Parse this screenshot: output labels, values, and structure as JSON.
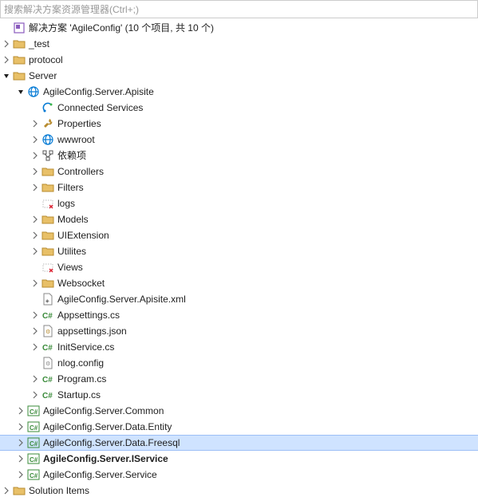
{
  "search": {
    "placeholder": "搜索解决方案资源管理器(Ctrl+;)"
  },
  "solution": {
    "label": "解决方案 'AgileConfig' (10 个项目, 共 10 个)"
  },
  "nodes": {
    "test": "_test",
    "protocol": "protocol",
    "server": "Server",
    "apisite": "AgileConfig.Server.Apisite",
    "connected_services": "Connected Services",
    "properties": "Properties",
    "wwwroot": "wwwroot",
    "dependencies": "依赖项",
    "controllers": "Controllers",
    "filters": "Filters",
    "logs": "logs",
    "models": "Models",
    "uiextension": "UIExtension",
    "utilites": "Utilites",
    "views": "Views",
    "websocket": "Websocket",
    "apisite_xml": "AgileConfig.Server.Apisite.xml",
    "appsettings_cs": "Appsettings.cs",
    "appsettings_json": "appsettings.json",
    "initservice_cs": "InitService.cs",
    "nlog_config": "nlog.config",
    "program_cs": "Program.cs",
    "startup_cs": "Startup.cs",
    "common": "AgileConfig.Server.Common",
    "data_entity": "AgileConfig.Server.Data.Entity",
    "data_freesql": "AgileConfig.Server.Data.Freesql",
    "iservice": "AgileConfig.Server.IService",
    "service": "AgileConfig.Server.Service",
    "solution_items": "Solution Items"
  }
}
